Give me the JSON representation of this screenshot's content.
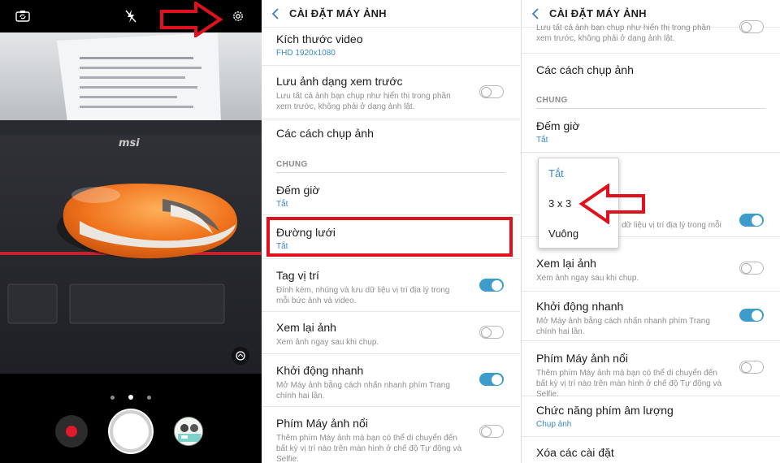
{
  "camera": {
    "icons": {
      "switch_camera": "camera-switch-icon",
      "flash": "flash-off-icon",
      "settings": "gear-icon",
      "lens": "lens-mode-icon"
    },
    "mode_dots": 3,
    "active_dot": 1
  },
  "settings_left": {
    "header": {
      "title": "CÀI ĐẶT MÁY ẢNH"
    },
    "video_size": {
      "label": "Kích thước video",
      "value": "FHD 1920x1080"
    },
    "save_preview": {
      "label": "Lưu ảnh dạng xem trước",
      "desc": "Lưu tất cả ảnh bạn chụp như hiển thị trong phần xem trước, không phải ở dạng ảnh lật.",
      "on": false
    },
    "shooting_methods": {
      "label": "Các cách chụp ảnh"
    },
    "section_general": "CHUNG",
    "timer": {
      "label": "Đếm giờ",
      "value": "Tắt"
    },
    "grid_lines": {
      "label": "Đường lưới",
      "value": "Tắt"
    },
    "location_tags": {
      "label": "Tag vị trí",
      "desc": "Đính kèm, nhúng và lưu dữ liệu vị trí địa lý trong mỗi bức ảnh và video.",
      "on": true
    },
    "review_pictures": {
      "label": "Xem lại ảnh",
      "desc": "Xem ảnh ngay sau khi chụp.",
      "on": false
    },
    "quick_launch": {
      "label": "Khởi động nhanh",
      "desc": "Mở Máy ảnh bằng cách nhấn nhanh phím Trang chính hai lần.",
      "on": true
    },
    "floating_button": {
      "label": "Phím Máy ảnh nổi",
      "desc": "Thêm phím Máy ảnh mà bạn có thể di chuyển đến bất kỳ vị trí nào trên màn hình ở chế độ Tự động và Selfie.",
      "on": false
    }
  },
  "settings_right": {
    "header": {
      "title": "CÀI ĐẶT MÁY ẢNH"
    },
    "top_partial_desc": "Lưu tất cả ảnh bạn chụp như hiển thị trong phần xem trước, không phải ở dạng ảnh lật.",
    "shooting_methods": {
      "label": "Các cách chụp ảnh"
    },
    "section_general": "CHUNG",
    "timer": {
      "label": "Đếm giờ",
      "value": "Tắt"
    },
    "location_partial_desc": "dữ liệu vị trí địa lý trong mỗi",
    "grid_dropdown": {
      "options": [
        "Tắt",
        "3 x 3",
        "Vuông"
      ],
      "selected": "Tắt"
    },
    "review_pictures": {
      "label": "Xem lại ảnh",
      "desc": "Xem ảnh ngay sau khi chụp.",
      "on": false
    },
    "quick_launch": {
      "label": "Khởi động nhanh",
      "desc": "Mở Máy ảnh bằng cách nhấn nhanh phím Trang chính hai lần.",
      "on": true
    },
    "floating_button": {
      "label": "Phím Máy ảnh nổi",
      "desc": "Thêm phím Máy ảnh mà bạn có thể di chuyển đến bất kỳ vị trí nào trên màn hình ở chế độ Tự động và Selfie.",
      "on": false
    },
    "volume_key": {
      "label": "Chức năng phím âm lượng",
      "value": "Chụp ảnh"
    },
    "reset": {
      "label": "Xóa các cài đặt"
    }
  },
  "annotations": {
    "arrow_color": "#e0111c",
    "highlight_color": "#e0111c"
  }
}
